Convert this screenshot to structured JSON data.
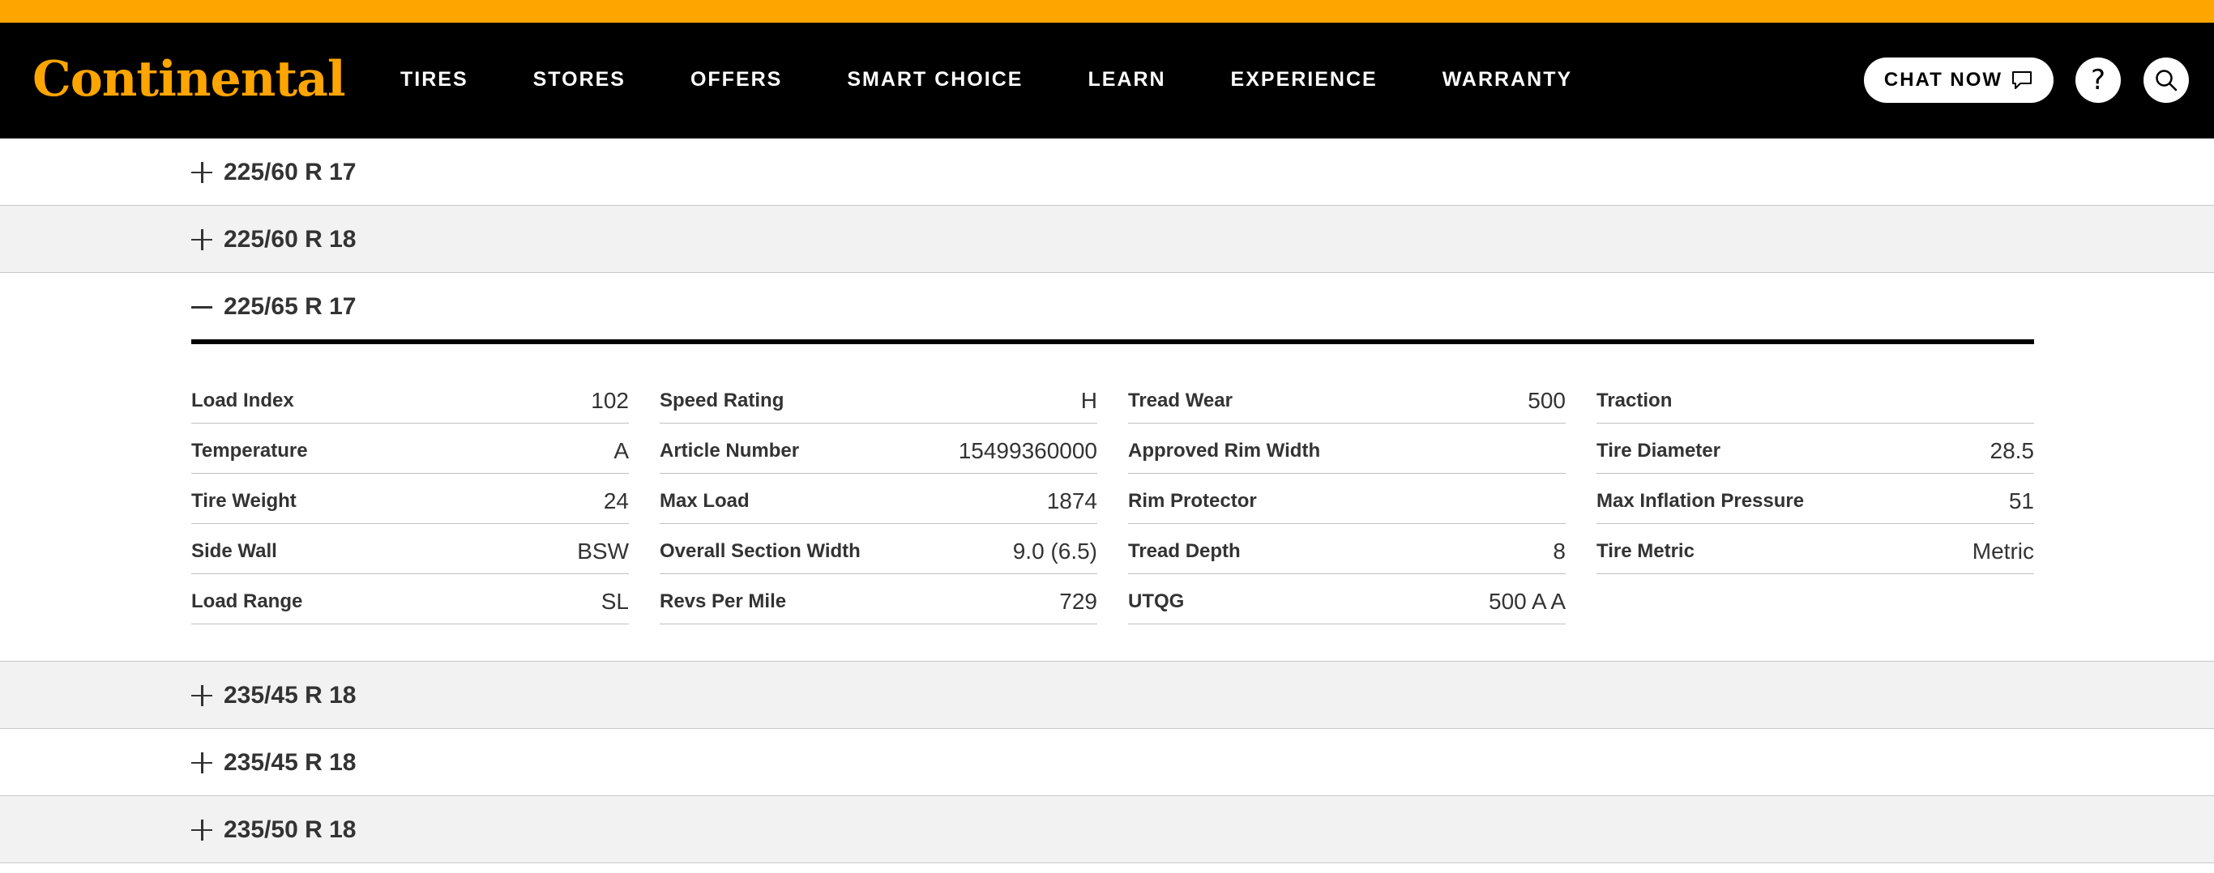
{
  "brand": {
    "name": "Continental",
    "accent": "#ffa500",
    "header_bg": "#000000"
  },
  "nav": {
    "items": [
      "TIRES",
      "STORES",
      "OFFERS",
      "SMART CHOICE",
      "LEARN",
      "EXPERIENCE",
      "WARRANTY"
    ]
  },
  "actions": {
    "chat_label": "CHAT NOW",
    "help_label": "?"
  },
  "sizes": {
    "before": [
      "225/60 R 17",
      "225/60 R 18"
    ],
    "expanded": "225/65 R 17",
    "after": [
      "235/45 R 18",
      "235/45 R 18",
      "235/50 R 18"
    ]
  },
  "specs": {
    "columns": [
      [
        {
          "label": "Load Index",
          "value": "102"
        },
        {
          "label": "Temperature",
          "value": "A"
        },
        {
          "label": "Tire Weight",
          "value": "24"
        },
        {
          "label": "Side Wall",
          "value": "BSW"
        },
        {
          "label": "Load Range",
          "value": "SL"
        }
      ],
      [
        {
          "label": "Speed Rating",
          "value": "H"
        },
        {
          "label": "Article Number",
          "value": "15499360000"
        },
        {
          "label": "Max Load",
          "value": "1874"
        },
        {
          "label": "Overall Section Width",
          "value": "9.0 (6.5)"
        },
        {
          "label": "Revs Per Mile",
          "value": "729"
        }
      ],
      [
        {
          "label": "Tread Wear",
          "value": "500"
        },
        {
          "label": "Approved Rim Width",
          "value": ""
        },
        {
          "label": "Rim Protector",
          "value": ""
        },
        {
          "label": "Tread Depth",
          "value": "8"
        },
        {
          "label": "UTQG",
          "value": "500 A A"
        }
      ],
      [
        {
          "label": "Traction",
          "value": ""
        },
        {
          "label": "Tire Diameter",
          "value": "28.5"
        },
        {
          "label": "Max Inflation Pressure",
          "value": "51"
        },
        {
          "label": "Tire Metric",
          "value": "Metric"
        }
      ]
    ]
  }
}
